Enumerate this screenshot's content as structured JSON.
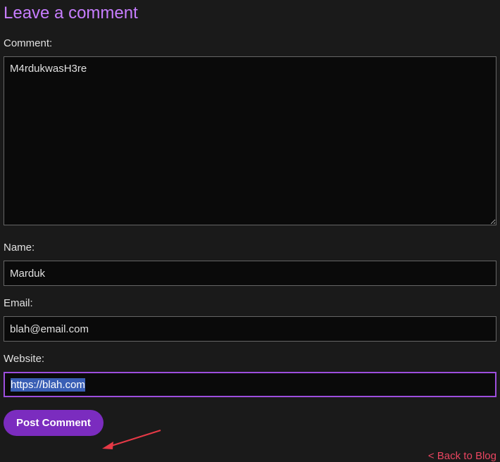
{
  "heading": "Leave a comment",
  "comment": {
    "label": "Comment:",
    "value": "M4rdukwasH3re"
  },
  "name": {
    "label": "Name:",
    "value": "Marduk"
  },
  "email": {
    "label": "Email:",
    "value": "blah@email.com"
  },
  "website": {
    "label": "Website:",
    "value": "https://blah.com"
  },
  "submit_label": "Post Comment",
  "back_link_text": "< Back to Blog",
  "colors": {
    "accent": "#c77dff",
    "button": "#7b2cbf",
    "link": "#e94560",
    "arrow": "#e63946"
  }
}
